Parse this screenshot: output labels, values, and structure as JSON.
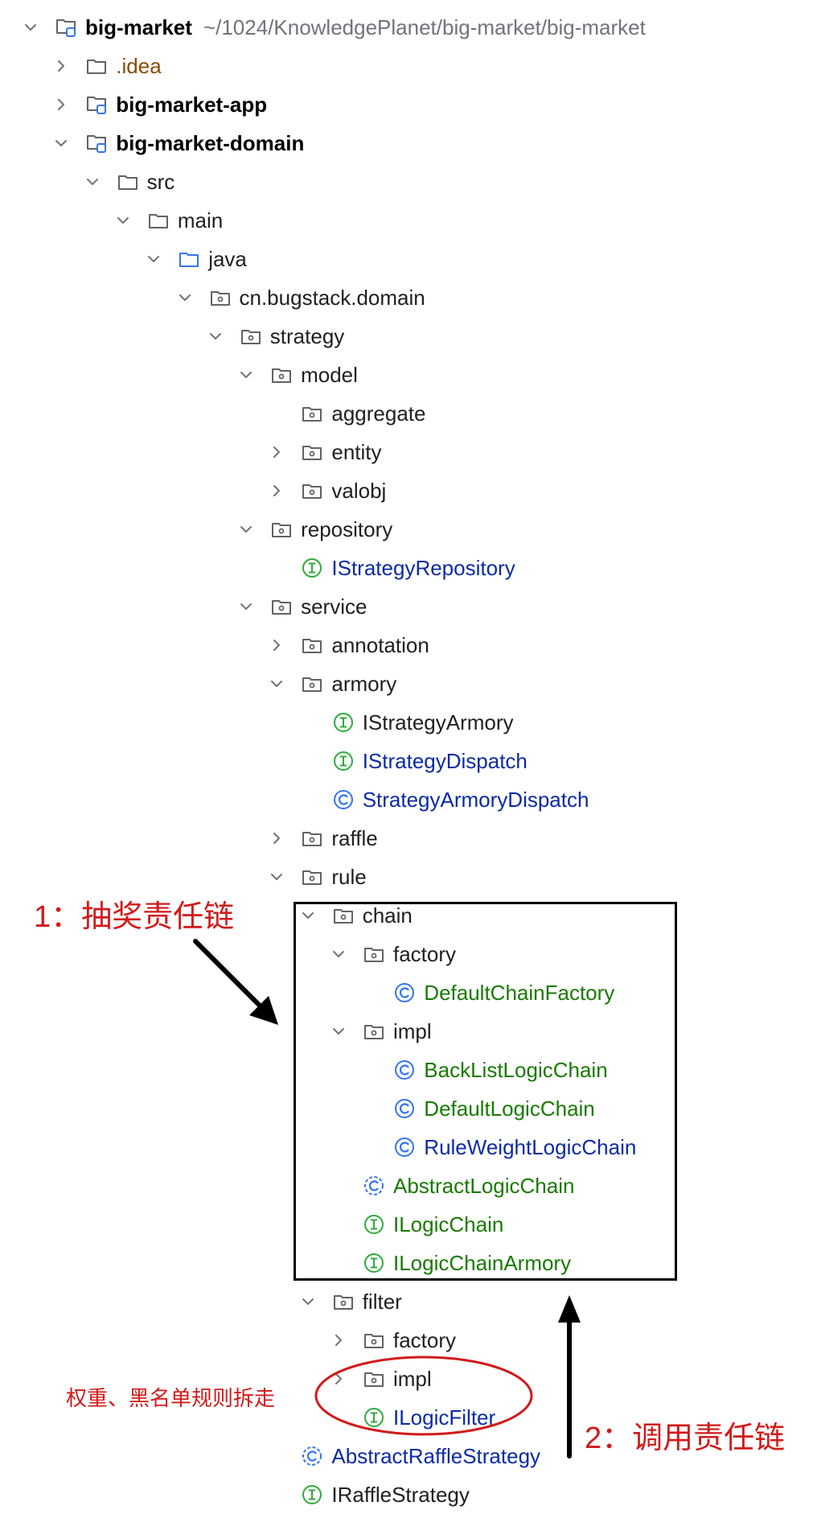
{
  "tree": [
    {
      "label": "big-market",
      "icon": "module-folder-icon",
      "expanded": true,
      "bold": true,
      "path": "~/1024/KnowledgePlanet/big-market/big-market"
    },
    {
      "label": ".idea",
      "icon": "folder-icon",
      "expanded": false,
      "color": "orange"
    },
    {
      "label": "big-market-app",
      "icon": "module-folder-icon",
      "expanded": false,
      "bold": true
    },
    {
      "label": "big-market-domain",
      "icon": "module-folder-icon",
      "expanded": true,
      "bold": true
    },
    {
      "label": "src",
      "icon": "folder-icon",
      "expanded": true
    },
    {
      "label": "main",
      "icon": "folder-icon",
      "expanded": true
    },
    {
      "label": "java",
      "icon": "source-folder-icon",
      "expanded": true
    },
    {
      "label": "cn.bugstack.domain",
      "icon": "package-icon",
      "expanded": true
    },
    {
      "label": "strategy",
      "icon": "package-icon",
      "expanded": true
    },
    {
      "label": "model",
      "icon": "package-icon",
      "expanded": true
    },
    {
      "label": "aggregate",
      "icon": "package-icon"
    },
    {
      "label": "entity",
      "icon": "package-icon",
      "expanded": false
    },
    {
      "label": "valobj",
      "icon": "package-icon",
      "expanded": false
    },
    {
      "label": "repository",
      "icon": "package-icon",
      "expanded": true
    },
    {
      "label": "IStrategyRepository",
      "icon": "interface-icon",
      "color": "blue"
    },
    {
      "label": "service",
      "icon": "package-icon",
      "expanded": true
    },
    {
      "label": "annotation",
      "icon": "package-icon",
      "expanded": false
    },
    {
      "label": "armory",
      "icon": "package-icon",
      "expanded": true
    },
    {
      "label": "IStrategyArmory",
      "icon": "interface-icon"
    },
    {
      "label": "IStrategyDispatch",
      "icon": "interface-icon",
      "color": "blue"
    },
    {
      "label": "StrategyArmoryDispatch",
      "icon": "class-icon",
      "color": "blue"
    },
    {
      "label": "raffle",
      "icon": "package-icon",
      "expanded": false
    },
    {
      "label": "rule",
      "icon": "package-icon",
      "expanded": true
    },
    {
      "label": "chain",
      "icon": "package-icon",
      "expanded": true
    },
    {
      "label": "factory",
      "icon": "package-icon",
      "expanded": true
    },
    {
      "label": "DefaultChainFactory",
      "icon": "class-icon",
      "color": "green"
    },
    {
      "label": "impl",
      "icon": "package-icon",
      "expanded": true
    },
    {
      "label": "BackListLogicChain",
      "icon": "class-icon",
      "color": "green"
    },
    {
      "label": "DefaultLogicChain",
      "icon": "class-icon",
      "color": "green"
    },
    {
      "label": "RuleWeightLogicChain",
      "icon": "class-icon",
      "color": "blue"
    },
    {
      "label": "AbstractLogicChain",
      "icon": "abstract-class-icon",
      "color": "green"
    },
    {
      "label": "ILogicChain",
      "icon": "interface-icon",
      "color": "green"
    },
    {
      "label": "ILogicChainArmory",
      "icon": "interface-icon",
      "color": "green"
    },
    {
      "label": "filter",
      "icon": "package-icon",
      "expanded": true
    },
    {
      "label": "factory",
      "icon": "package-icon",
      "expanded": false
    },
    {
      "label": "impl",
      "icon": "package-icon",
      "expanded": false
    },
    {
      "label": "ILogicFilter",
      "icon": "interface-icon",
      "color": "blue"
    },
    {
      "label": "AbstractRaffleStrategy",
      "icon": "abstract-class-icon",
      "color": "blue"
    },
    {
      "label": "IRaffleStrategy",
      "icon": "interface-icon"
    }
  ],
  "annotations": {
    "chain_note": "1：抽奖责任链",
    "call_note": "2：调用责任链",
    "removed_note": "权重、黑名单规则拆走"
  },
  "colors": {
    "text": "#1f1f1f",
    "path": "#6f737a",
    "orange": "#8a4b00",
    "blue": "#0b2aa6",
    "green": "#187a00",
    "interface_icon": "#2eab3a",
    "class_icon": "#3574f0",
    "annotation_red": "#d21a1a",
    "box": "#000000"
  }
}
